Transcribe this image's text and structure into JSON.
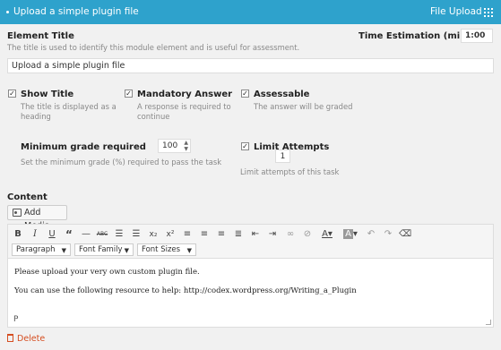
{
  "header": {
    "title": "Upload a simple plugin file",
    "element_type": "File Upload",
    "color": "#2ea2cc"
  },
  "element_title": {
    "label": "Element Title",
    "help": "The title is used to identify this module element and is useful for assessment.",
    "value": "Upload a simple plugin file"
  },
  "time_estimation": {
    "label": "Time Estimation (mins)",
    "value": "1:00"
  },
  "options": {
    "show_title": {
      "label": "Show Title",
      "help": "The title is displayed as a heading",
      "checked": true
    },
    "mandatory": {
      "label": "Mandatory Answer",
      "help": "A response is required to continue",
      "checked": true
    },
    "assessable": {
      "label": "Assessable",
      "help": "The answer will be graded",
      "checked": true
    }
  },
  "min_grade": {
    "label": "Minimum grade required",
    "value": "100",
    "help": "Set the minimum grade (%) required to pass the task"
  },
  "limit_attempts": {
    "label": "Limit Attempts",
    "value": "1",
    "help": "Limit attempts of this task",
    "checked": true
  },
  "content": {
    "label": "Content",
    "add_media": "Add Media",
    "format_select": "Paragraph",
    "font_family_select": "Font Family",
    "font_size_select": "Font Sizes",
    "lines": [
      "Please upload your very own custom plugin file.",
      "You can use the following resource to help: http://codex.wordpress.org/Writing_a_Plugin"
    ],
    "status_path": "P"
  },
  "toolbar_icons": [
    "bold-icon",
    "italic-icon",
    "underline-icon",
    "blockquote-icon",
    "horizontal-rule-icon",
    "strikethrough-icon",
    "bullet-list-icon",
    "numbered-list-icon",
    "subscript-icon",
    "superscript-icon",
    "align-left-icon",
    "align-center-icon",
    "align-right-icon",
    "align-justify-icon",
    "outdent-icon",
    "indent-icon",
    "link-icon",
    "unlink-icon",
    "text-color-icon",
    "background-color-icon",
    "undo-icon",
    "redo-icon",
    "clear-formatting-icon"
  ],
  "footer": {
    "delete": "Delete",
    "delete_color": "#d54e21"
  }
}
